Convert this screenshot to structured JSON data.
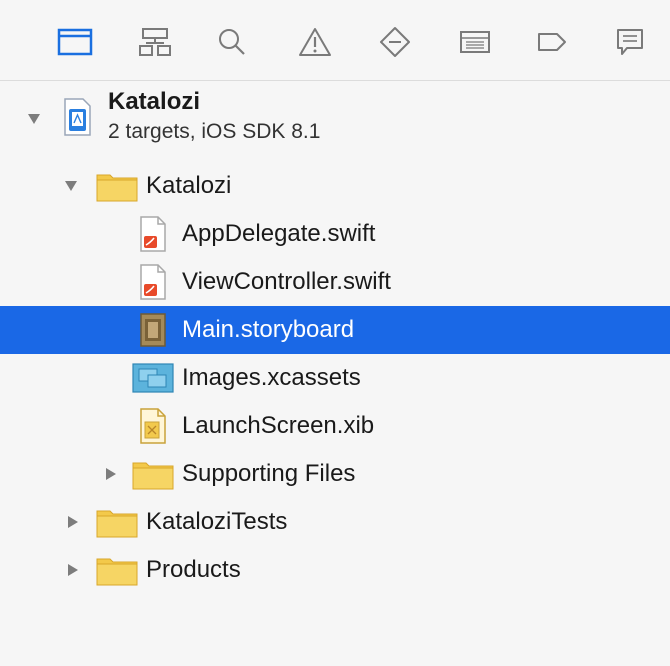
{
  "toolbar": {
    "icons": [
      {
        "name": "folder-icon",
        "active": true
      },
      {
        "name": "hierarchy-icon",
        "active": false
      },
      {
        "name": "search-icon",
        "active": false
      },
      {
        "name": "warning-icon",
        "active": false
      },
      {
        "name": "breakpoint-icon",
        "active": false
      },
      {
        "name": "debug-icon",
        "active": false
      },
      {
        "name": "tag-icon",
        "active": false
      },
      {
        "name": "log-icon",
        "active": false
      }
    ],
    "active_color": "#1a6fe0",
    "inactive_color": "#7a7a7a"
  },
  "project": {
    "name": "Katalozi",
    "subtitle": "2 targets, iOS SDK 8.1"
  },
  "tree": {
    "group_katalozi": "Katalozi",
    "files": {
      "app_delegate": "AppDelegate.swift",
      "view_controller": "ViewController.swift",
      "main_storyboard": "Main.storyboard",
      "images": "Images.xcassets",
      "launch_screen": "LaunchScreen.xib"
    },
    "supporting_files": "Supporting Files",
    "tests_group": "KataloziTests",
    "products_group": "Products"
  },
  "selection": {
    "selected_item": "Main.storyboard",
    "highlight_color": "#1a68e6"
  }
}
